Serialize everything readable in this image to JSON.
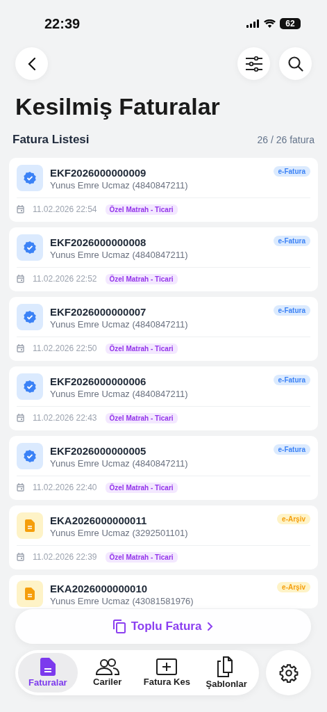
{
  "status_bar": {
    "time": "22:39",
    "battery": "62"
  },
  "title": "Kesilmiş Faturalar",
  "section": {
    "title": "Fatura Listesi",
    "count": "26 / 26 fatura"
  },
  "invoices": [
    {
      "kind": "efatura",
      "number": "EKF2026000000009",
      "customer": "Yunus Emre Ucmaz (4840847211)",
      "type": "e-Fatura",
      "date": "11.02.2026 22:54",
      "tag": "Özel Matrah - Ticari"
    },
    {
      "kind": "efatura",
      "number": "EKF2026000000008",
      "customer": "Yunus Emre Ucmaz (4840847211)",
      "type": "e-Fatura",
      "date": "11.02.2026 22:52",
      "tag": "Özel Matrah - Ticari"
    },
    {
      "kind": "efatura",
      "number": "EKF2026000000007",
      "customer": "Yunus Emre Ucmaz (4840847211)",
      "type": "e-Fatura",
      "date": "11.02.2026 22:50",
      "tag": "Özel Matrah - Ticari"
    },
    {
      "kind": "efatura",
      "number": "EKF2026000000006",
      "customer": "Yunus Emre Ucmaz (4840847211)",
      "type": "e-Fatura",
      "date": "11.02.2026 22:43",
      "tag": "Özel Matrah - Ticari"
    },
    {
      "kind": "efatura",
      "number": "EKF2026000000005",
      "customer": "Yunus Emre Ucmaz (4840847211)",
      "type": "e-Fatura",
      "date": "11.02.2026 22:40",
      "tag": "Özel Matrah - Ticari"
    },
    {
      "kind": "earsiv",
      "number": "EKA2026000000011",
      "customer": "Yunus Emre Ucmaz (3292501101)",
      "type": "e-Arşiv",
      "date": "11.02.2026 22:39",
      "tag": "Özel Matrah - Ticari"
    },
    {
      "kind": "earsiv",
      "number": "EKA2026000000010",
      "customer": "Yunus Emre Ucmaz (43081581976)",
      "type": "e-Arşiv"
    }
  ],
  "bulk_button": {
    "label": "Toplu Fatura"
  },
  "tabs": [
    {
      "kind": "invoices",
      "label": "Faturalar",
      "selected": true
    },
    {
      "kind": "contacts",
      "label": "Cariler",
      "selected": false
    },
    {
      "kind": "create",
      "label": "Fatura Kes",
      "selected": false
    },
    {
      "kind": "templates",
      "label": "Şablonlar",
      "selected": false
    }
  ]
}
